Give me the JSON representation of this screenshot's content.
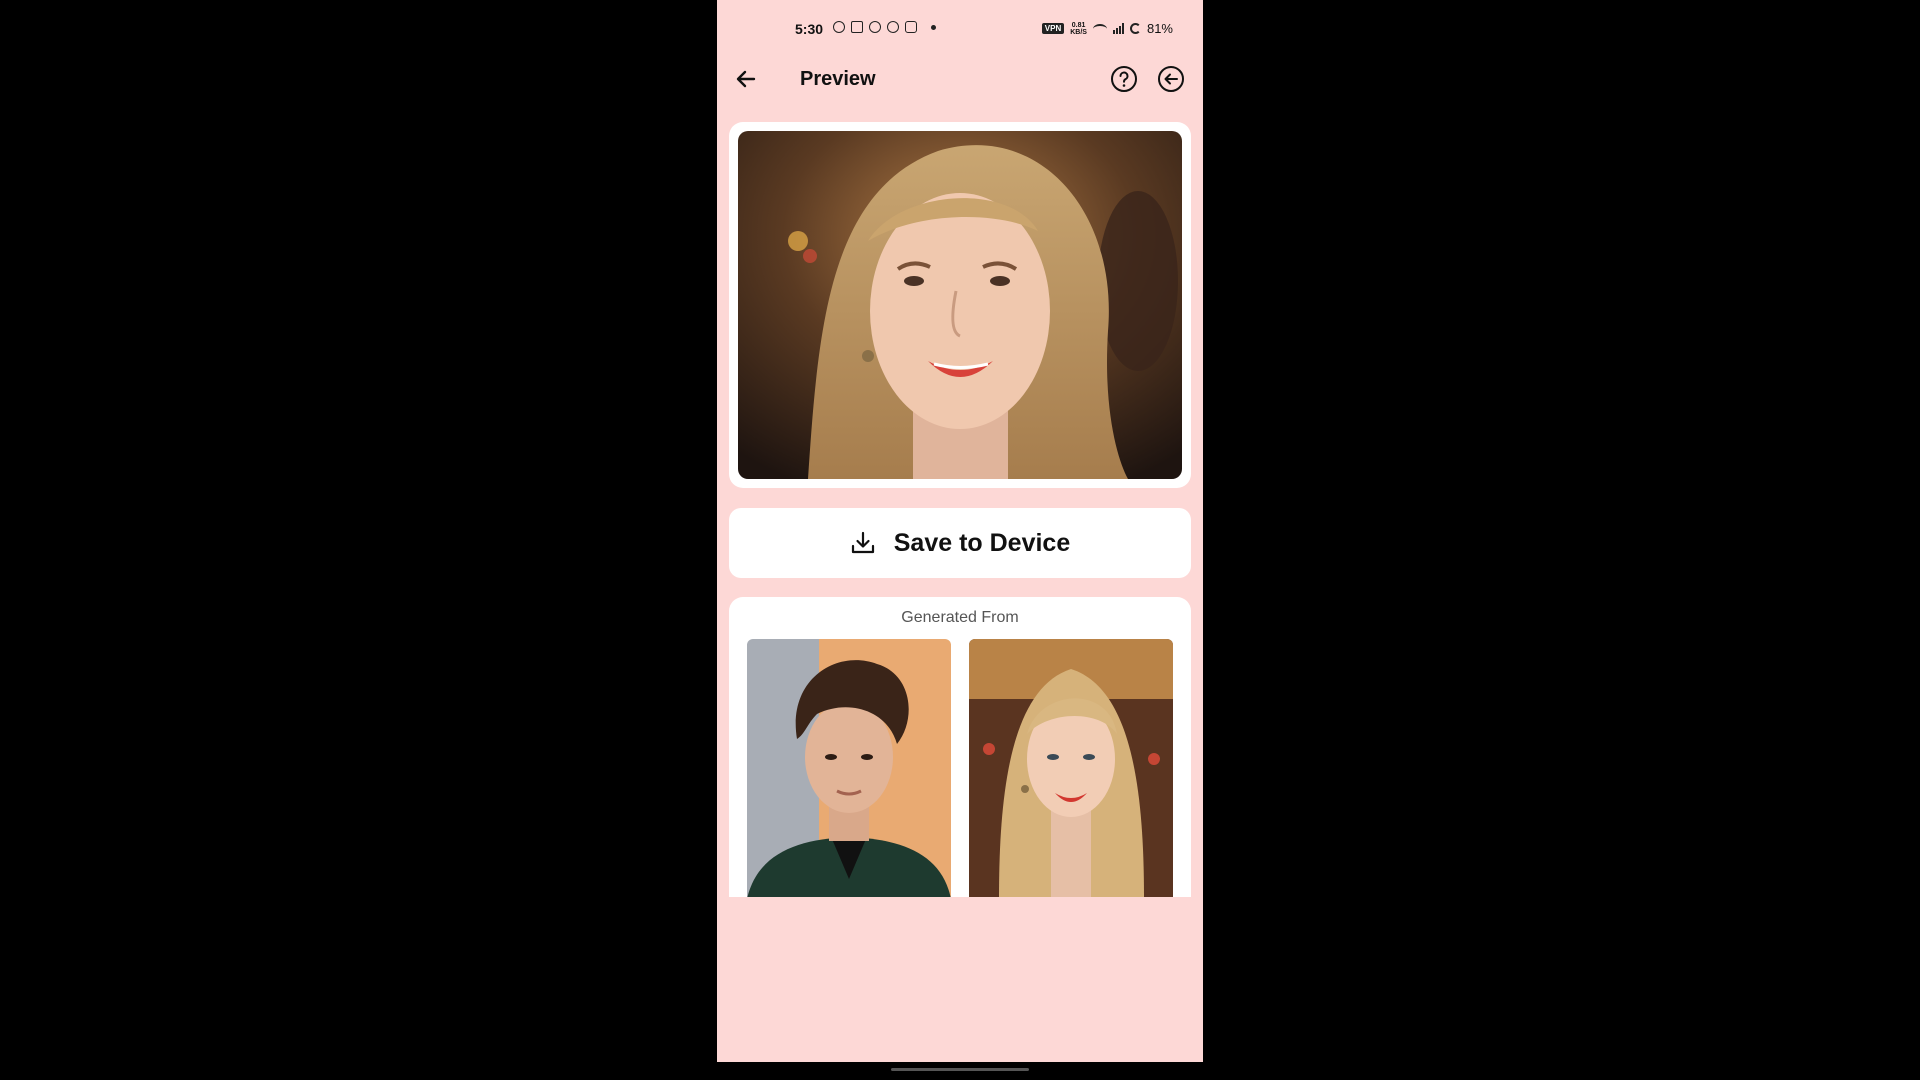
{
  "status_bar": {
    "time": "5:30",
    "vpn_label": "VPN",
    "net_speed": "0.81",
    "net_unit": "KB/S",
    "battery": "81%"
  },
  "app_bar": {
    "title": "Preview"
  },
  "actions": {
    "save_label": "Save to Device"
  },
  "source": {
    "heading": "Generated From"
  },
  "colors": {
    "background": "#fdd8d6",
    "card": "#ffffff"
  },
  "icons": {
    "back": "arrow-left-icon",
    "help": "question-circle-icon",
    "exit": "arrow-left-circle-icon",
    "download": "download-icon"
  }
}
